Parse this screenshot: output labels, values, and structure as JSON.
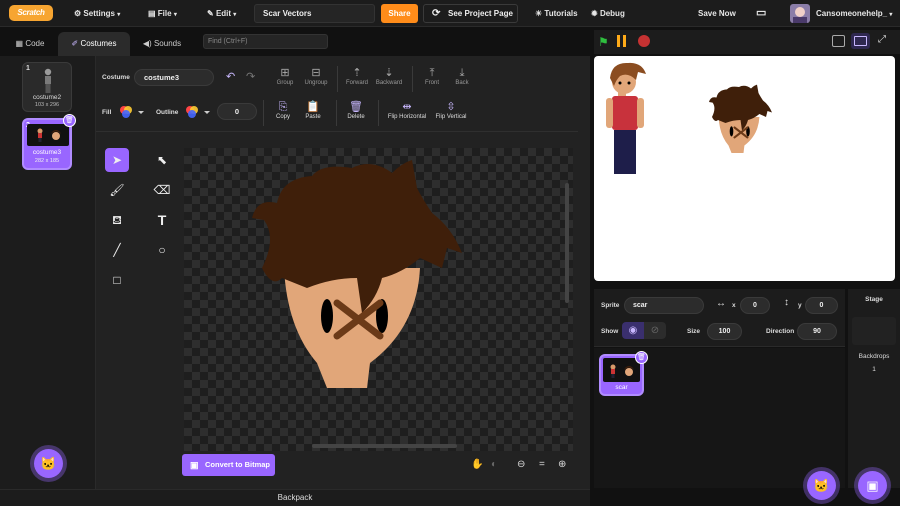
{
  "menubar": {
    "logo_text": "Scratch",
    "settings": "Settings",
    "file": "File",
    "edit": "Edit",
    "project_title": "Scar Vectors",
    "share": "Share",
    "see_project_page": "See Project Page",
    "tutorials": "Tutorials",
    "debug": "Debug",
    "save_now": "Save Now",
    "username": "Cansomeonehelp_"
  },
  "tabs": {
    "code": "Code",
    "costumes": "Costumes",
    "sounds": "Sounds",
    "find_placeholder": "Find (Ctrl+F)"
  },
  "costumes": [
    {
      "number": "1",
      "name": "costume2",
      "size": "103 x 296"
    },
    {
      "number": "2",
      "name": "costume3",
      "size": "282 x 185"
    }
  ],
  "paint": {
    "costume_label": "Costume",
    "costume_name": "costume3",
    "fill_label": "Fill",
    "outline_label": "Outline",
    "outline_width": "0",
    "buttons": {
      "group": "Group",
      "ungroup": "Ungroup",
      "forward": "Forward",
      "backward": "Backward",
      "front": "Front",
      "back": "Back",
      "copy": "Copy",
      "paste": "Paste",
      "delete": "Delete",
      "flip_horizontal": "Flip Horizontal",
      "flip_vertical": "Flip Vertical"
    },
    "convert_to_bitmap": "Convert to Bitmap",
    "zoom_reset": "="
  },
  "sprite": {
    "sprite_label": "Sprite",
    "name": "scar",
    "x_label": "x",
    "x": "0",
    "y_label": "y",
    "y": "0",
    "show_label": "Show",
    "size_label": "Size",
    "size": "100",
    "direction_label": "Direction",
    "direction": "90",
    "list": [
      {
        "name": "scar"
      }
    ]
  },
  "stage_panel": {
    "title": "Stage",
    "backdrops_label": "Backdrops",
    "backdrops_count": "1"
  },
  "backpack": "Backpack",
  "colors": {
    "accent": "#9966ff",
    "share": "#ff8c1a",
    "hair": "#3f1f0a",
    "skin": "#e1a679"
  }
}
